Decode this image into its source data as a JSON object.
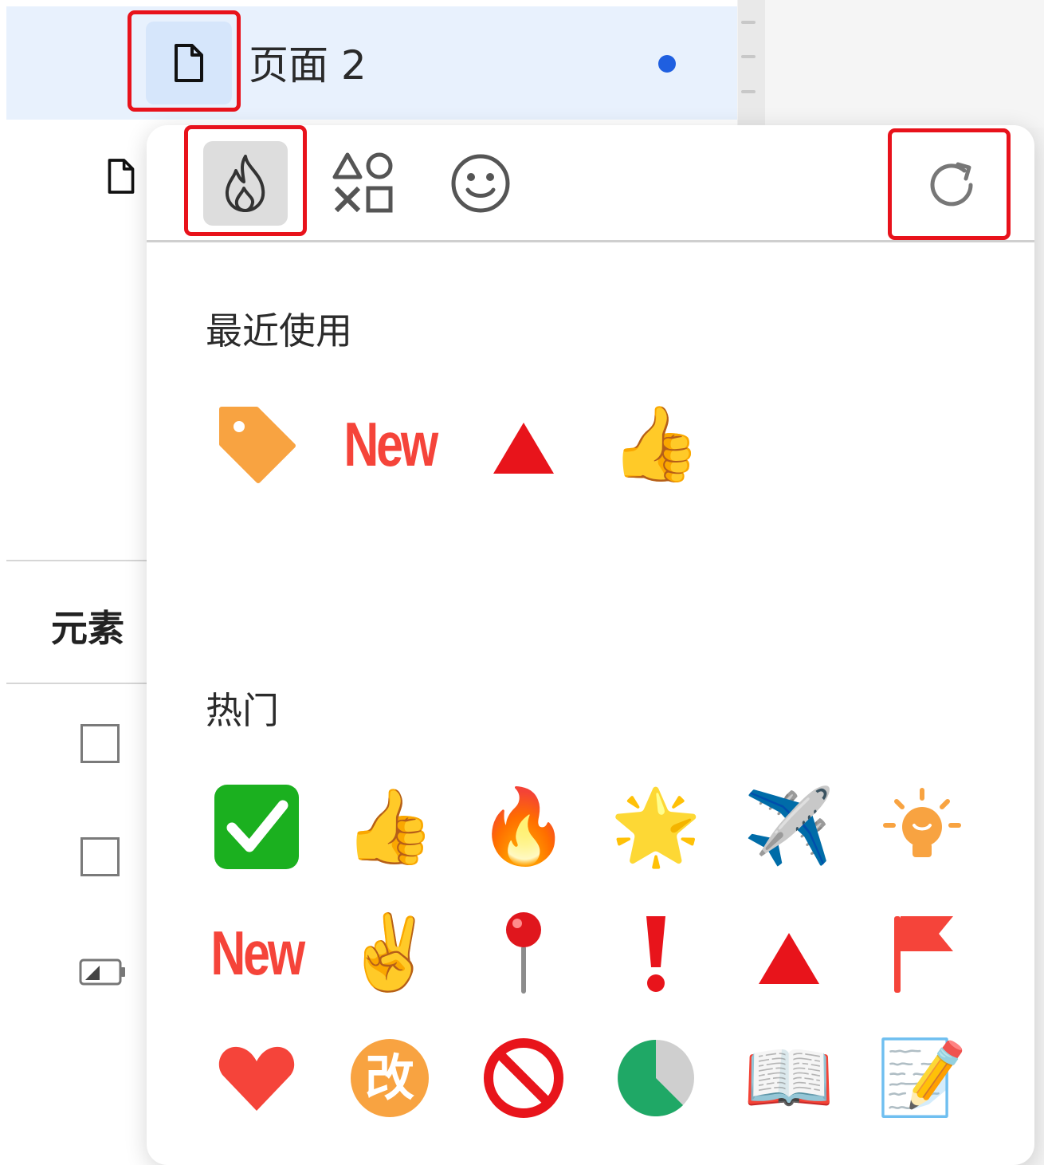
{
  "sidebar": {
    "page_title": "页面 2",
    "section_label": "元素"
  },
  "popover": {
    "tabs": [
      {
        "name": "hot-icon-tab",
        "icon": "flame-icon",
        "active": true
      },
      {
        "name": "shapes-icon-tab",
        "icon": "shapes-icon",
        "active": false
      },
      {
        "name": "emoji-icon-tab",
        "icon": "smiley-icon",
        "active": false
      }
    ],
    "refresh_icon": "refresh-icon",
    "recent_title": "最近使用",
    "hot_title": "热门",
    "recent": [
      {
        "name": "tag-emoji",
        "glyph": "🏷️"
      },
      {
        "name": "new-label-emoji",
        "text": "New"
      },
      {
        "name": "red-triangle-emoji",
        "glyph": "▲"
      },
      {
        "name": "thumbs-up-emoji",
        "glyph": "👍"
      }
    ],
    "hot": [
      {
        "name": "check-mark-emoji",
        "glyph": "✅"
      },
      {
        "name": "thumbs-up-emoji",
        "glyph": "👍"
      },
      {
        "name": "fire-emoji",
        "glyph": "🔥"
      },
      {
        "name": "glowing-star-emoji",
        "glyph": "🌟"
      },
      {
        "name": "airplane-emoji",
        "glyph": "✈️"
      },
      {
        "name": "light-bulb-emoji",
        "glyph": "💡"
      },
      {
        "name": "new-label-emoji",
        "text": "New"
      },
      {
        "name": "victory-hand-emoji",
        "glyph": "✌️"
      },
      {
        "name": "pushpin-emoji",
        "glyph": "📍"
      },
      {
        "name": "exclamation-emoji",
        "glyph": "❗"
      },
      {
        "name": "red-triangle-emoji",
        "glyph": "▲"
      },
      {
        "name": "red-flag-emoji",
        "glyph": "🚩"
      },
      {
        "name": "heart-emoji",
        "glyph": "❤"
      },
      {
        "name": "modify-badge-emoji",
        "text": "改"
      },
      {
        "name": "prohibited-emoji",
        "glyph": "🚫"
      },
      {
        "name": "pie-progress-emoji",
        "glyph": "◔"
      },
      {
        "name": "open-book-emoji",
        "glyph": "📖"
      },
      {
        "name": "memo-emoji",
        "glyph": "📝"
      }
    ]
  },
  "colors": {
    "accent_blue": "#1f5fe0",
    "highlight_red": "#e8121b",
    "new_red": "#f5443a"
  }
}
